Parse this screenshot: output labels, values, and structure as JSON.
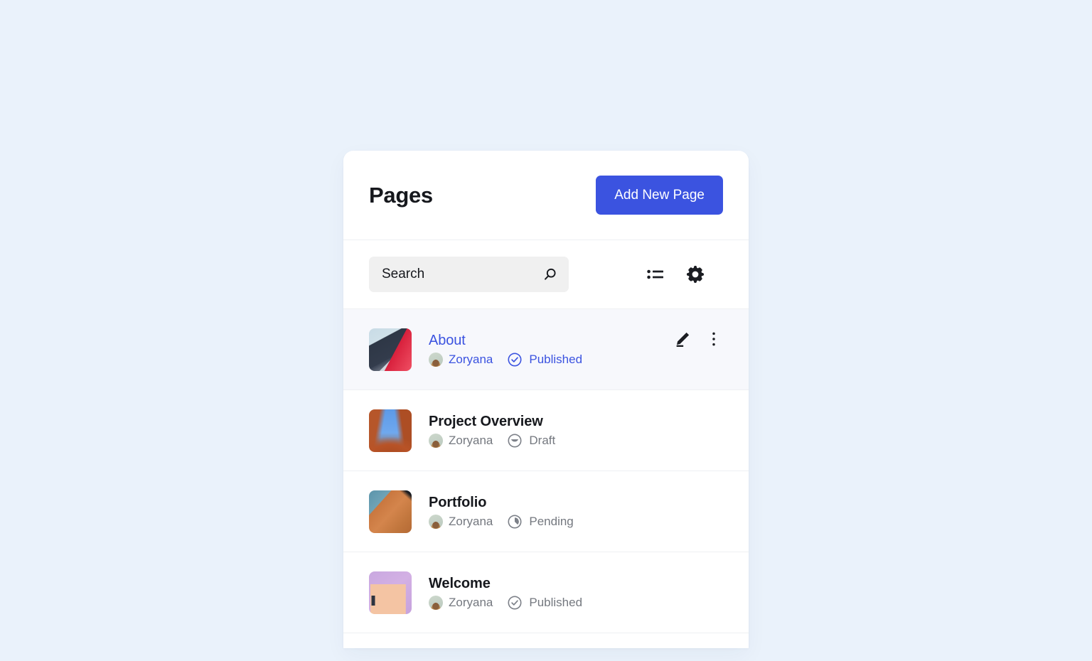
{
  "theme": {
    "accent": "#3b53e0",
    "backdrop": "#eaf2fb",
    "card_bg": "#ffffff",
    "selected_row_bg": "#f7f8fc",
    "muted_text": "#74787f",
    "title_text": "#16181d",
    "search_bg": "#f0f0f0",
    "divider": "#eef0f3"
  },
  "header": {
    "title": "Pages",
    "add_button_label": "Add New Page"
  },
  "toolbar": {
    "search": {
      "value": "",
      "placeholder": "Search",
      "icon": "search-icon"
    },
    "actions": [
      {
        "name": "list-view-button",
        "icon": "list-view-icon"
      },
      {
        "name": "settings-button",
        "icon": "gear-icon"
      }
    ]
  },
  "pages": [
    {
      "title": "About",
      "author": "Zoryana",
      "status": "Published",
      "status_icon": "check-circle-icon",
      "selected": true,
      "thumbnail": "architecture-navy-red-thumbnail",
      "actions": [
        {
          "name": "edit-page-button",
          "icon": "pencil-icon",
          "label": "Edit"
        },
        {
          "name": "more-options-button",
          "icon": "more-vertical-icon",
          "label": "More"
        }
      ]
    },
    {
      "title": "Project Overview",
      "author": "Zoryana",
      "status": "Draft",
      "status_icon": "draft-circle-icon",
      "selected": false,
      "thumbnail": "rust-sculpture-blue-sky-thumbnail",
      "actions": []
    },
    {
      "title": "Portfolio",
      "author": "Zoryana",
      "status": "Pending",
      "status_icon": "pending-clock-icon",
      "selected": false,
      "thumbnail": "orange-dune-teal-sky-thumbnail",
      "actions": []
    },
    {
      "title": "Welcome",
      "author": "Zoryana",
      "status": "Published",
      "status_icon": "check-circle-icon",
      "selected": false,
      "thumbnail": "lavender-peach-wall-thumbnail",
      "actions": []
    }
  ]
}
